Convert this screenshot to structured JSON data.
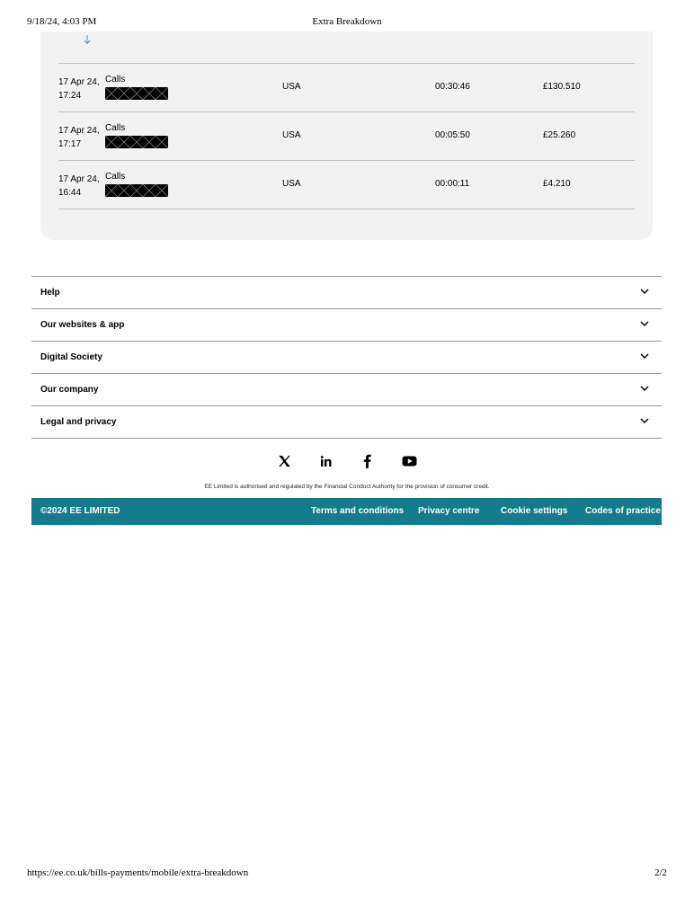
{
  "print_header": {
    "datetime": "9/18/24, 4:03 PM",
    "title": "Extra Breakdown"
  },
  "print_footer": {
    "url": "https://ee.co.uk/bills-payments/mobile/extra-breakdown",
    "page": "2/2"
  },
  "breakdown": {
    "sort_icon": "arrow-down-icon",
    "rows": [
      {
        "date": "17 Apr 24, 17:24",
        "type": "Calls",
        "country": "USA",
        "duration": "00:30:46",
        "cost": "£130.510"
      },
      {
        "date": "17 Apr 24, 17:17",
        "type": "Calls",
        "country": "USA",
        "duration": "00:05:50",
        "cost": "£25.260"
      },
      {
        "date": "17 Apr 24, 16:44",
        "type": "Calls",
        "country": "USA",
        "duration": "00:00:11",
        "cost": "£4.210"
      }
    ]
  },
  "footer_nav": {
    "items": [
      {
        "label": "Help"
      },
      {
        "label": "Our websites & app"
      },
      {
        "label": "Digital Society"
      },
      {
        "label": "Our company"
      },
      {
        "label": "Legal and privacy"
      }
    ]
  },
  "social": {
    "icons": [
      "x-icon",
      "linkedin-icon",
      "facebook-icon",
      "youtube-icon"
    ]
  },
  "legal_note": "EE Limited is authorised and regulated by the Financial Conduct Authority for the provision of consumer credit.",
  "bottom_bar": {
    "copyright": "©2024 EE LIMITED",
    "links": [
      "Terms and conditions",
      "Privacy centre",
      "Cookie settings",
      "Codes of practice"
    ],
    "color": "#137b8c"
  }
}
